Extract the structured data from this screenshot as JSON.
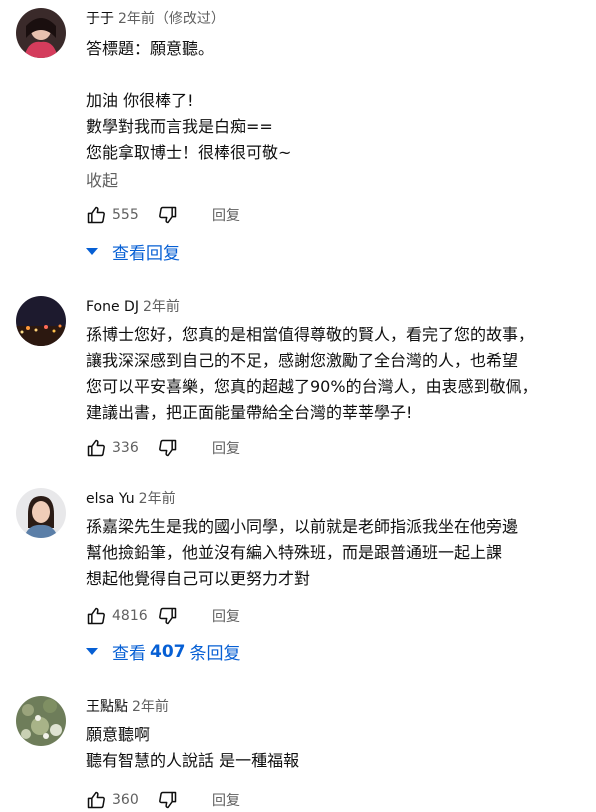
{
  "comments": [
    {
      "author": "于于",
      "time": "2年前（修改过）",
      "lines": [
        "答標題：願意聽。",
        "",
        "加油 你很棒了!",
        "數學對我而言我是白痴==",
        "您能拿取博士！很棒很可敬~"
      ],
      "collapse_label": "收起",
      "likes": "555",
      "reply_label": "回复",
      "replies_label": "查看回复",
      "replies_count": ""
    },
    {
      "author": "Fone DJ",
      "time": "2年前",
      "lines": [
        "孫博士您好，您真的是相當值得尊敬的賢人，看完了您的故事，",
        "讓我深深感到自己的不足，感謝您激勵了全台灣的人，也希望",
        "您可以平安喜樂，您真的超越了90%的台灣人，由衷感到敬佩，",
        "建議出書，把正面能量帶給全台灣的莘莘學子!"
      ],
      "likes": "336",
      "reply_label": "回复"
    },
    {
      "author": "elsa Yu",
      "time": "2年前",
      "lines": [
        "孫嘉梁先生是我的國小同學，以前就是老師指派我坐在他旁邊",
        "幫他撿鉛筆，他並沒有編入特殊班，而是跟普通班一起上課",
        "想起他覺得自己可以更努力才對"
      ],
      "likes": "4816",
      "reply_label": "回复",
      "replies_prefix": "查看",
      "replies_count": "407",
      "replies_suffix": "条回复"
    },
    {
      "author": "王點點",
      "time": "2年前",
      "lines": [
        "願意聽啊",
        "聽有智慧的人說話 是一種福報"
      ],
      "likes": "360",
      "reply_label": "回复"
    }
  ],
  "icons": {
    "like": "thumb-up-icon",
    "dislike": "thumb-down-icon",
    "expand": "caret-down-icon"
  },
  "colors": {
    "link": "#065fd4",
    "secondary": "#606060"
  }
}
